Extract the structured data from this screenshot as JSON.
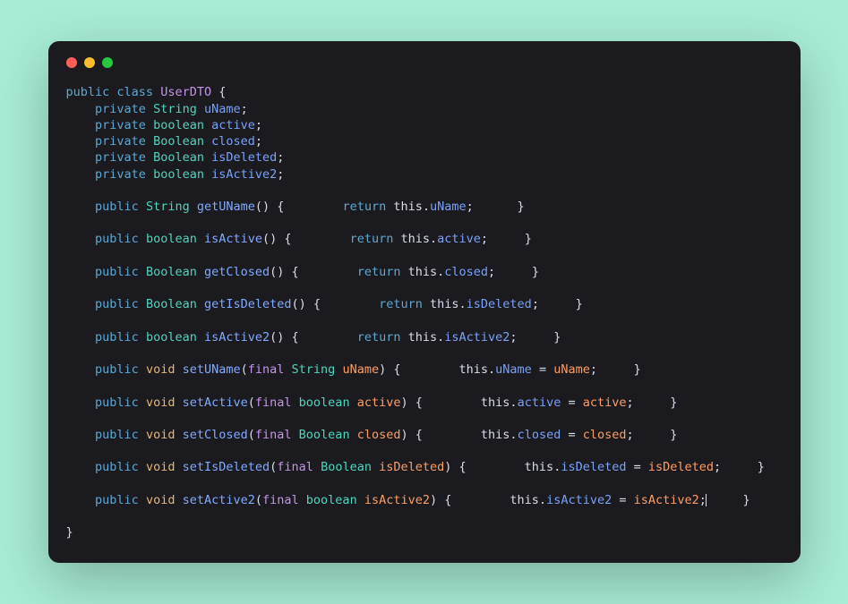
{
  "window": {
    "traffic_lights": [
      "red",
      "yellow",
      "green"
    ]
  },
  "code": {
    "class_decl": {
      "public": "public",
      "class": "class",
      "name": "UserDTO",
      "open": " {"
    },
    "fields": [
      {
        "indent": "    ",
        "access": "private",
        "type": "String",
        "name": "uName",
        "semi": ";"
      },
      {
        "indent": "    ",
        "access": "private",
        "type": "boolean",
        "name": "active",
        "semi": ";"
      },
      {
        "indent": "    ",
        "access": "private",
        "type": "Boolean",
        "name": "closed",
        "semi": ";"
      },
      {
        "indent": "    ",
        "access": "private",
        "type": "Boolean",
        "name": "isDeleted",
        "semi": ";"
      },
      {
        "indent": "    ",
        "access": "private",
        "type": "boolean",
        "name": "isActive2",
        "semi": ";"
      }
    ],
    "getters": [
      {
        "indent": "    ",
        "access": "public",
        "type": "String",
        "name": "getUName",
        "parens": "() {        ",
        "return": "return",
        "this": "this",
        "dot": ".",
        "field": "uName",
        "tail": ";      }"
      },
      {
        "indent": "    ",
        "access": "public",
        "type": "boolean",
        "name": "isActive",
        "parens": "() {        ",
        "return": "return",
        "this": "this",
        "dot": ".",
        "field": "active",
        "tail": ";     }"
      },
      {
        "indent": "    ",
        "access": "public",
        "type": "Boolean",
        "name": "getClosed",
        "parens": "() {        ",
        "return": "return",
        "this": "this",
        "dot": ".",
        "field": "closed",
        "tail": ";     }"
      },
      {
        "indent": "    ",
        "access": "public",
        "type": "Boolean",
        "name": "getIsDeleted",
        "parens": "() {        ",
        "return": "return",
        "this": "this",
        "dot": ".",
        "field": "isDeleted",
        "tail": ";     }"
      },
      {
        "indent": "    ",
        "access": "public",
        "type": "boolean",
        "name": "isActive2",
        "parens": "() {        ",
        "return": "return",
        "this": "this",
        "dot": ".",
        "field": "isActive2",
        "tail": ";     }"
      }
    ],
    "setters": [
      {
        "indent": "    ",
        "access": "public",
        "void": "void",
        "name": "setUName",
        "open": "(",
        "final": "final",
        "ptype": "String",
        "pname": "uName",
        "close": ") {        ",
        "this": "this",
        "dot": ".",
        "field": "uName",
        "eq": " = ",
        "rhs": "uName",
        "tail": ";     }"
      },
      {
        "indent": "    ",
        "access": "public",
        "void": "void",
        "name": "setActive",
        "open": "(",
        "final": "final",
        "ptype": "boolean",
        "pname": "active",
        "close": ") {        ",
        "this": "this",
        "dot": ".",
        "field": "active",
        "eq": " = ",
        "rhs": "active",
        "tail": ";     }"
      },
      {
        "indent": "    ",
        "access": "public",
        "void": "void",
        "name": "setClosed",
        "open": "(",
        "final": "final",
        "ptype": "Boolean",
        "pname": "closed",
        "close": ") {        ",
        "this": "this",
        "dot": ".",
        "field": "closed",
        "eq": " = ",
        "rhs": "closed",
        "tail": ";     }"
      },
      {
        "indent": "    ",
        "access": "public",
        "void": "void",
        "name": "setIsDeleted",
        "open": "(",
        "final": "final",
        "ptype": "Boolean",
        "pname": "isDeleted",
        "close": ") {        ",
        "this": "this",
        "dot": ".",
        "field": "isDeleted",
        "eq": " = ",
        "rhs": "isDeleted",
        "tail": ";     }"
      },
      {
        "indent": "    ",
        "access": "public",
        "void": "void",
        "name": "setActive2",
        "open": "(",
        "final": "final",
        "ptype": "boolean",
        "pname": "isActive2",
        "close": ") {        ",
        "this": "this",
        "dot": ".",
        "field": "isActive2",
        "eq": " = ",
        "rhs": "isActive2",
        "tail": ";",
        "cursor": true,
        "tail2": "     }"
      }
    ],
    "close": "}"
  }
}
